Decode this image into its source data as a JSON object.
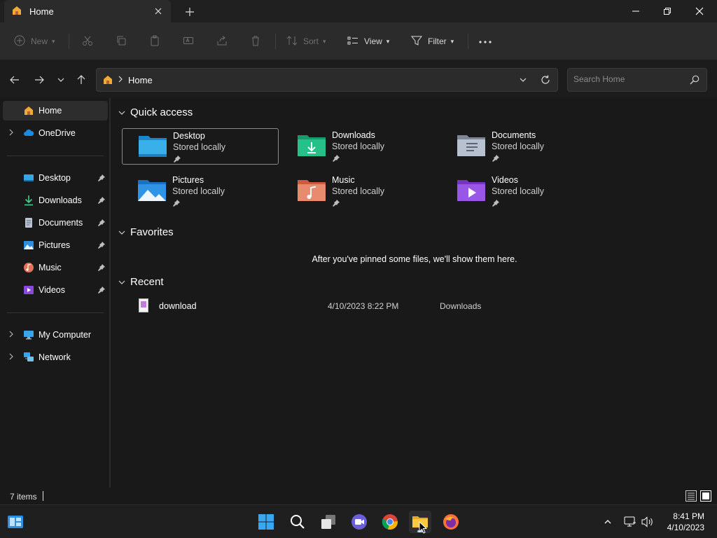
{
  "window": {
    "tab_title": "Home"
  },
  "toolbar": {
    "new_label": "New",
    "sort_label": "Sort",
    "view_label": "View",
    "filter_label": "Filter"
  },
  "address": {
    "crumb": "Home",
    "search_placeholder": "Search Home"
  },
  "sidebar": {
    "home": "Home",
    "onedrive": "OneDrive",
    "pinned": [
      {
        "label": "Desktop"
      },
      {
        "label": "Downloads"
      },
      {
        "label": "Documents"
      },
      {
        "label": "Pictures"
      },
      {
        "label": "Music"
      },
      {
        "label": "Videos"
      }
    ],
    "my_computer": "My Computer",
    "network": "Network"
  },
  "main": {
    "quick_access_title": "Quick access",
    "quick_access": [
      {
        "name": "Desktop",
        "sub": "Stored locally"
      },
      {
        "name": "Downloads",
        "sub": "Stored locally"
      },
      {
        "name": "Documents",
        "sub": "Stored locally"
      },
      {
        "name": "Pictures",
        "sub": "Stored locally"
      },
      {
        "name": "Music",
        "sub": "Stored locally"
      },
      {
        "name": "Videos",
        "sub": "Stored locally"
      }
    ],
    "favorites_title": "Favorites",
    "favorites_empty": "After you've pinned some files, we'll show them here.",
    "recent_title": "Recent",
    "recent": [
      {
        "name": "download",
        "date": "4/10/2023 8:22 PM",
        "location": "Downloads"
      }
    ]
  },
  "status": {
    "item_count": "7 items"
  },
  "taskbar": {
    "time": "8:41 PM",
    "date": "4/10/2023"
  },
  "colors": {
    "accent": "#0078d4",
    "background": "#191919",
    "toolbar": "#2b2b2b"
  }
}
